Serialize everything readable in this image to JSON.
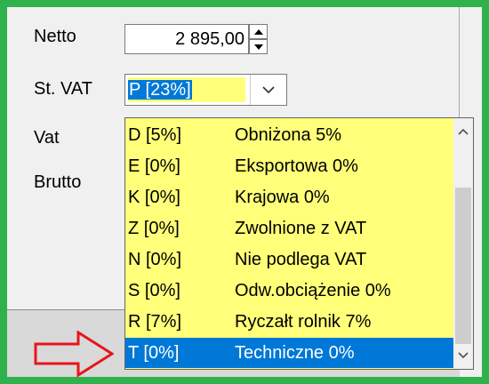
{
  "form": {
    "netto_label": "Netto",
    "netto_value": "2 895,00",
    "vat_rate_label": "St. VAT",
    "vat_rate_value": "P [23%]",
    "vat_label": "Vat",
    "brutto_label": "Brutto"
  },
  "dropdown": {
    "items": [
      {
        "code": "D [5%]",
        "desc": "Obniżona 5%"
      },
      {
        "code": "E [0%]",
        "desc": "Eksportowa 0%"
      },
      {
        "code": "K [0%]",
        "desc": "Krajowa 0%"
      },
      {
        "code": "Z [0%]",
        "desc": "Zwolnione z VAT"
      },
      {
        "code": "N [0%]",
        "desc": "Nie podlega VAT"
      },
      {
        "code": "S [0%]",
        "desc": "Odw.obciążenie 0%"
      },
      {
        "code": "R [7%]",
        "desc": "Ryczałt rolnik 7%"
      },
      {
        "code": "T [0%]",
        "desc": "Techniczne 0%"
      }
    ],
    "selected_index": 7
  },
  "colors": {
    "frame_border": "#2fb24c",
    "field_highlight": "#ffff7a",
    "selection": "#0078d7",
    "annotation_arrow": "#e8141c"
  },
  "icons": {
    "spin_up": "triangle-up-icon",
    "spin_down": "triangle-down-icon",
    "combo": "chevron-down-icon",
    "scroll_up": "chevron-up-icon",
    "scroll_down": "chevron-down-icon",
    "annotation": "right-arrow-icon"
  }
}
